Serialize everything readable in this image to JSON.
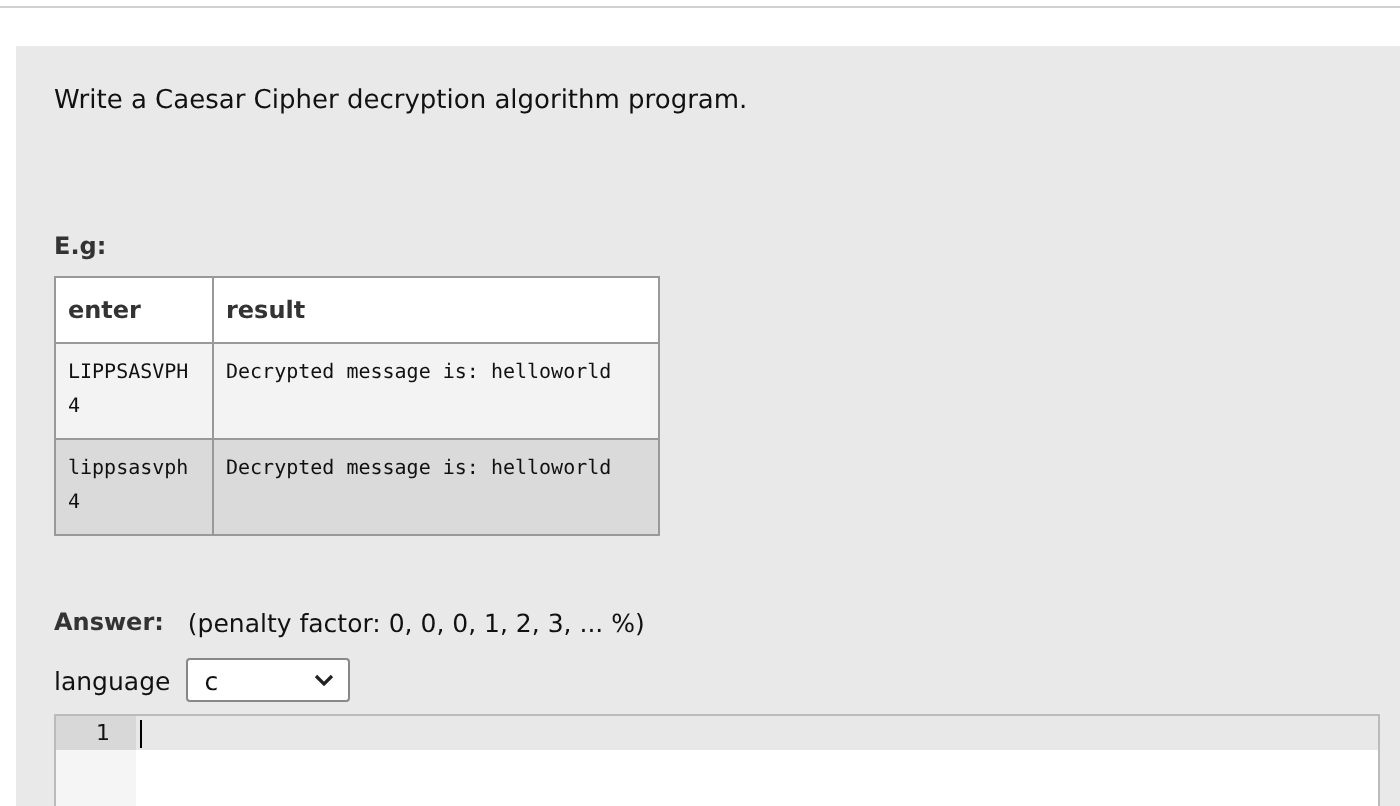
{
  "question": {
    "text": "Write a Caesar Cipher decryption algorithm program.",
    "example_label": "E.g:"
  },
  "table": {
    "columns": [
      "enter",
      "result"
    ],
    "rows": [
      {
        "enter": [
          "LIPPSASVPH",
          "4"
        ],
        "result": "Decrypted message is: helloworld"
      },
      {
        "enter": [
          "lippsasvph",
          "4"
        ],
        "result": "Decrypted message is: helloworld"
      }
    ]
  },
  "answer": {
    "label": "Answer:",
    "penalty": "(penalty factor: 0, 0, 0, 1, 2, 3, ... %)",
    "language_label": "language",
    "language": "c"
  },
  "editor": {
    "line_numbers": [
      "1"
    ]
  }
}
